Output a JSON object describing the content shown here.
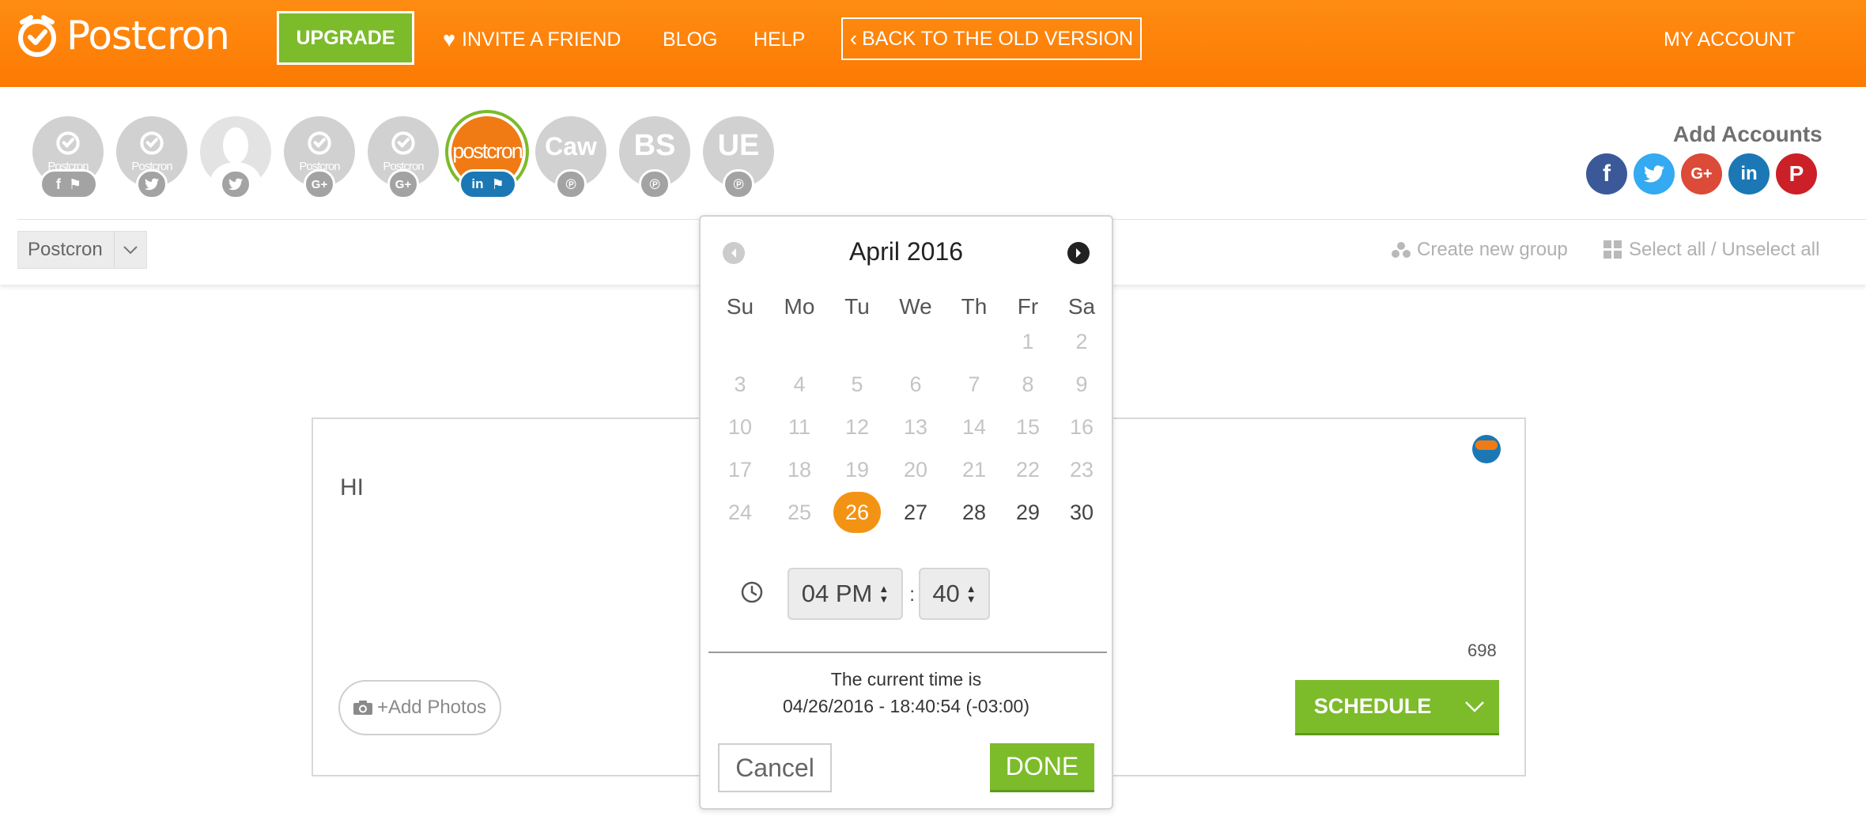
{
  "topbar": {
    "brand": "Postcron",
    "upgrade_label": "UPGRADE",
    "invite_label": "INVITE A FRIEND",
    "blog_label": "BLOG",
    "help_label": "HELP",
    "back_old_label": "BACK TO THE OLD VERSION",
    "my_account_label": "MY ACCOUNT",
    "brand_color": "#fc7a03"
  },
  "accounts": {
    "items": [
      {
        "initials": "",
        "avatar_text": "Postcron",
        "networks": [
          "facebook-icon",
          "flag-icon"
        ],
        "selected": false
      },
      {
        "initials": "",
        "avatar_text": "Postcron",
        "networks": [
          "twitter-icon"
        ],
        "selected": false
      },
      {
        "initials": "",
        "avatar_text": "",
        "networks": [
          "twitter-icon"
        ],
        "selected": false
      },
      {
        "initials": "",
        "avatar_text": "Postcron",
        "networks": [
          "google-plus-icon"
        ],
        "selected": false
      },
      {
        "initials": "",
        "avatar_text": "Postcron",
        "networks": [
          "google-plus-icon"
        ],
        "selected": false
      },
      {
        "initials": "",
        "avatar_text": "postcron",
        "networks": [
          "linkedin-icon",
          "flag-icon"
        ],
        "selected": true
      },
      {
        "initials": "Caw",
        "avatar_text": "",
        "networks": [
          "pinterest-icon"
        ],
        "selected": false
      },
      {
        "initials": "BS",
        "avatar_text": "",
        "networks": [
          "pinterest-icon"
        ],
        "selected": false
      },
      {
        "initials": "UE",
        "avatar_text": "",
        "networks": [
          "pinterest-icon"
        ],
        "selected": false
      }
    ],
    "add_accounts_label": "Add Accounts",
    "add_networks": [
      {
        "icon": "facebook-icon",
        "glyph": "f",
        "color": "#3b5998"
      },
      {
        "icon": "twitter-icon",
        "glyph": "",
        "color": "#33aaf1"
      },
      {
        "icon": "google-plus-icon",
        "glyph": "G+",
        "color": "#dc4a38"
      },
      {
        "icon": "linkedin-icon",
        "glyph": "in",
        "color": "#1c78b4"
      },
      {
        "icon": "pinterest-icon",
        "glyph": "P",
        "color": "#cb2027"
      }
    ],
    "group_select_value": "Postcron",
    "create_group_label": "Create new group",
    "select_all_label": "Select all / Unselect all"
  },
  "composer": {
    "text": "HI",
    "char_count": "698",
    "add_photos_label": "+Add Photos",
    "schedule_label": "SCHEDULE"
  },
  "datepicker": {
    "month_label": "April 2016",
    "weekdays": [
      "Su",
      "Mo",
      "Tu",
      "We",
      "Th",
      "Fr",
      "Sa"
    ],
    "weeks": [
      [
        "",
        "",
        "",
        "",
        "",
        "1",
        "2"
      ],
      [
        "3",
        "4",
        "5",
        "6",
        "7",
        "8",
        "9"
      ],
      [
        "10",
        "11",
        "12",
        "13",
        "14",
        "15",
        "16"
      ],
      [
        "17",
        "18",
        "19",
        "20",
        "21",
        "22",
        "23"
      ],
      [
        "24",
        "25",
        "26",
        "27",
        "28",
        "29",
        "30"
      ]
    ],
    "selected_day": "26",
    "hour_value": "04 PM",
    "minute_value": "40",
    "time_separator": ":",
    "current_time_label": "The current time is",
    "current_time_value": "04/26/2016 - 18:40:54 (-03:00)",
    "cancel_label": "Cancel",
    "done_label": "DONE",
    "selected_color": "#f39314"
  }
}
